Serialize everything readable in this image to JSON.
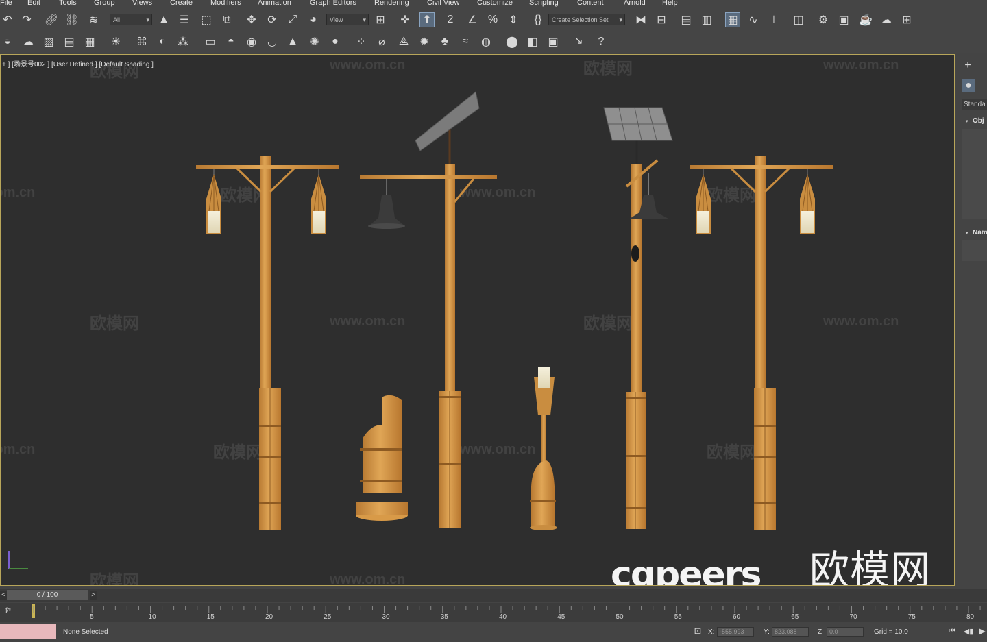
{
  "menu": [
    "File",
    "Edit",
    "Tools",
    "Group",
    "Views",
    "Create",
    "Modifiers",
    "Animation",
    "Graph Editors",
    "Rendering",
    "Civil View",
    "Customize",
    "Scripting",
    "Content",
    "Arnold",
    "Help"
  ],
  "toolbar": {
    "selection_filter": "All",
    "ref_coord": "View",
    "named_selection": "Create Selection Set"
  },
  "viewport": {
    "label": "+ ] [场景号002 ] [User Defined ] [Default Shading ]",
    "watermark_url": "www.om.cn",
    "watermark_cn": "欧模网"
  },
  "brand": {
    "cgpeers": "cgpeers",
    "om": "欧模网"
  },
  "command_panel": {
    "dropdown": "Standa",
    "rollout1": "Obj",
    "rollout2": "Nam"
  },
  "timeslider": {
    "position": "0 / 100",
    "prev": "<",
    "next": ">"
  },
  "timeline": {
    "ticks": [
      "0",
      "5",
      "10",
      "15",
      "20",
      "25",
      "30",
      "35",
      "40",
      "45",
      "50",
      "55",
      "60",
      "65",
      "70",
      "75",
      "80"
    ]
  },
  "status": {
    "selection": "None Selected",
    "x_label": "X:",
    "x_value": "-555.993",
    "y_label": "Y:",
    "y_value": "823.088",
    "z_label": "Z:",
    "z_value": "0.0",
    "grid": "Grid = 10.0"
  },
  "colors": {
    "bamboo": "#d99a45",
    "viewport_bg": "#2e2e2e",
    "viewport_border": "#b8a65a"
  }
}
